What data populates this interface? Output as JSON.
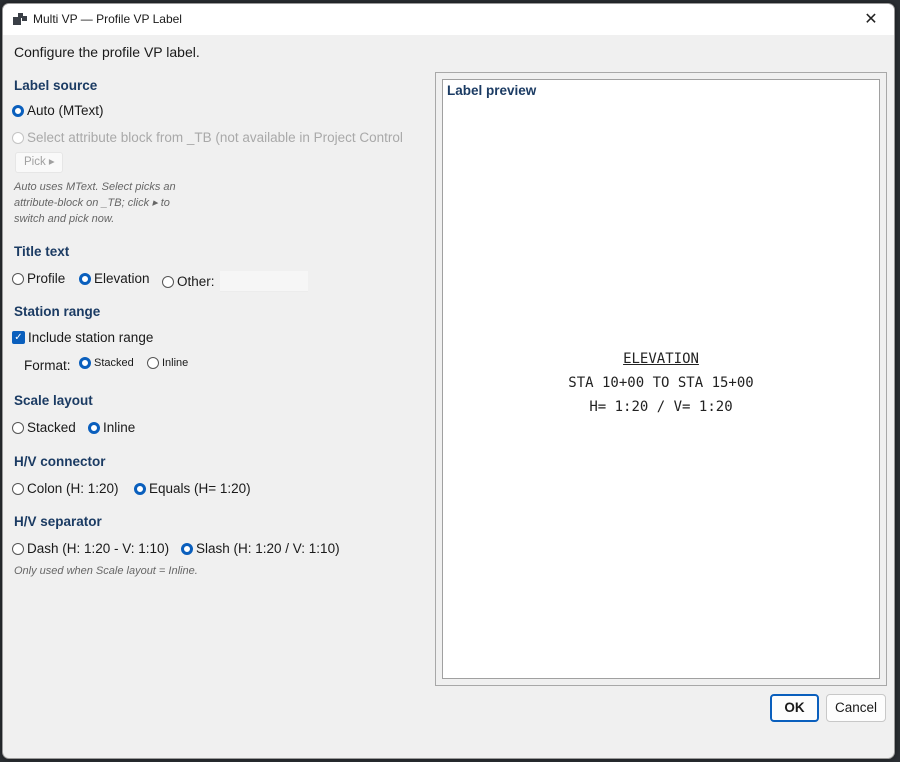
{
  "window": {
    "title": "Multi VP — Profile VP Label",
    "close_glyph": "✕"
  },
  "subtitle": "Configure the profile VP label.",
  "label_source": {
    "heading": "Label source",
    "auto": "Auto (MText)",
    "select": "Select attribute block from _TB  (not available in Project Control",
    "pick": "Pick ▸",
    "hint": [
      "Auto uses MText. Select picks an",
      "attribute-block on _TB; click ▸ to",
      "switch and pick now."
    ]
  },
  "title_text": {
    "heading": "Title text",
    "profile": "Profile",
    "elevation": "Elevation",
    "other": "Other:",
    "other_value": ""
  },
  "station_range": {
    "heading": "Station range",
    "include": "Include station range",
    "format_label": "Format:",
    "stacked": "Stacked",
    "inline": "Inline"
  },
  "scale_layout": {
    "heading": "Scale layout",
    "stacked": "Stacked",
    "inline": "Inline"
  },
  "hv_connector": {
    "heading": "H/V connector",
    "colon": "Colon  (H: 1:20)",
    "equals": "Equals  (H= 1:20)"
  },
  "hv_separator": {
    "heading": "H/V separator",
    "dash": "Dash  (H: 1:20 - V: 1:10)",
    "slash": "Slash  (H: 1:20 / V: 1:10)",
    "hint": "Only used when Scale layout = Inline."
  },
  "preview": {
    "heading": "Label preview",
    "line1": "ELEVATION",
    "line2": "STA 10+00 TO STA 15+00",
    "line3": "H= 1:20 / V= 1:20"
  },
  "buttons": {
    "ok": "OK",
    "cancel": "Cancel"
  },
  "selection": {
    "label_source": "auto",
    "title_text": "elevation",
    "include_station_range": true,
    "station_format": "stacked",
    "scale_layout": "inline",
    "hv_connector": "equals",
    "hv_separator": "slash"
  },
  "colors": {
    "accent": "#0a5fbd",
    "heading": "#1b3b63"
  },
  "icons": {
    "app": "window-icon",
    "close": "close-icon"
  }
}
